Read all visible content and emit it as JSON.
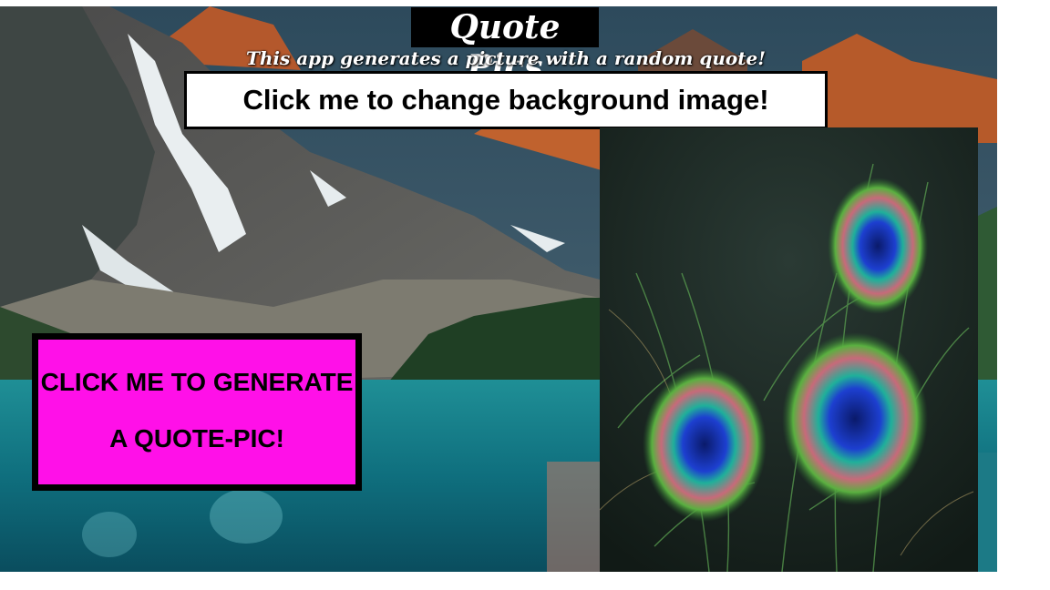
{
  "app": {
    "title": "Quote Pics",
    "subtitle": "This app generates a picture with a random quote!"
  },
  "buttons": {
    "change_background": "Click me to change background image!",
    "generate_line1": "CLICK ME TO GENERATE",
    "generate_line2": "A QUOTE-PIC!"
  },
  "images": {
    "background": "mountain-lake-landscape",
    "quote_picture": "peacock-feathers"
  },
  "colors": {
    "generate_button": "#ff10e8",
    "change_button": "#ffffff",
    "title_bg": "#000000"
  }
}
